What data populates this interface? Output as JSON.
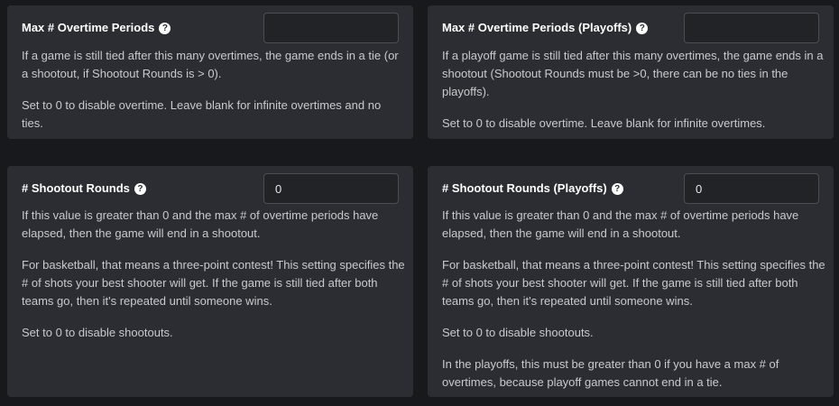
{
  "cards": [
    {
      "title": "Max # Overtime Periods",
      "input_value": "",
      "paragraphs": [
        "If a game is still tied after this many overtimes, the game ends in a tie (or a shootout, if Shootout Rounds is > 0).",
        "Set to 0 to disable overtime. Leave blank for infinite overtimes and no ties."
      ]
    },
    {
      "title": "Max # Overtime Periods (Playoffs)",
      "input_value": "",
      "paragraphs": [
        "If a playoff game is still tied after this many overtimes, the game ends in a shootout (Shootout Rounds must be >0, there can be no ties in the playoffs).",
        "Set to 0 to disable overtime. Leave blank for infinite overtimes."
      ]
    },
    {
      "title": "# Shootout Rounds",
      "input_value": "0",
      "paragraphs": [
        "If this value is greater than 0 and the max # of overtime periods have elapsed, then the game will end in a shootout.",
        "For basketball, that means a three-point contest! This setting specifies the # of shots your best shooter will get. If the game is still tied after both teams go, then it's repeated until someone wins.",
        "Set to 0 to disable shootouts."
      ]
    },
    {
      "title": "# Shootout Rounds (Playoffs)",
      "input_value": "0",
      "paragraphs": [
        "If this value is greater than 0 and the max # of overtime periods have elapsed, then the game will end in a shootout.",
        "For basketball, that means a three-point contest! This setting specifies the # of shots your best shooter will get. If the game is still tied after both teams go, then it's repeated until someone wins.",
        "Set to 0 to disable shootouts.",
        "In the playoffs, this must be greater than 0 if you have a max # of overtimes, because playoff games cannot end in a tie."
      ]
    }
  ],
  "help_icon_glyph": "?",
  "colors": {
    "background": "#18191c",
    "card": "#2b2d32",
    "input_bg": "#212327",
    "input_border": "#4a4d54",
    "title_text": "#ffffff",
    "body_text": "#c9cacd"
  }
}
